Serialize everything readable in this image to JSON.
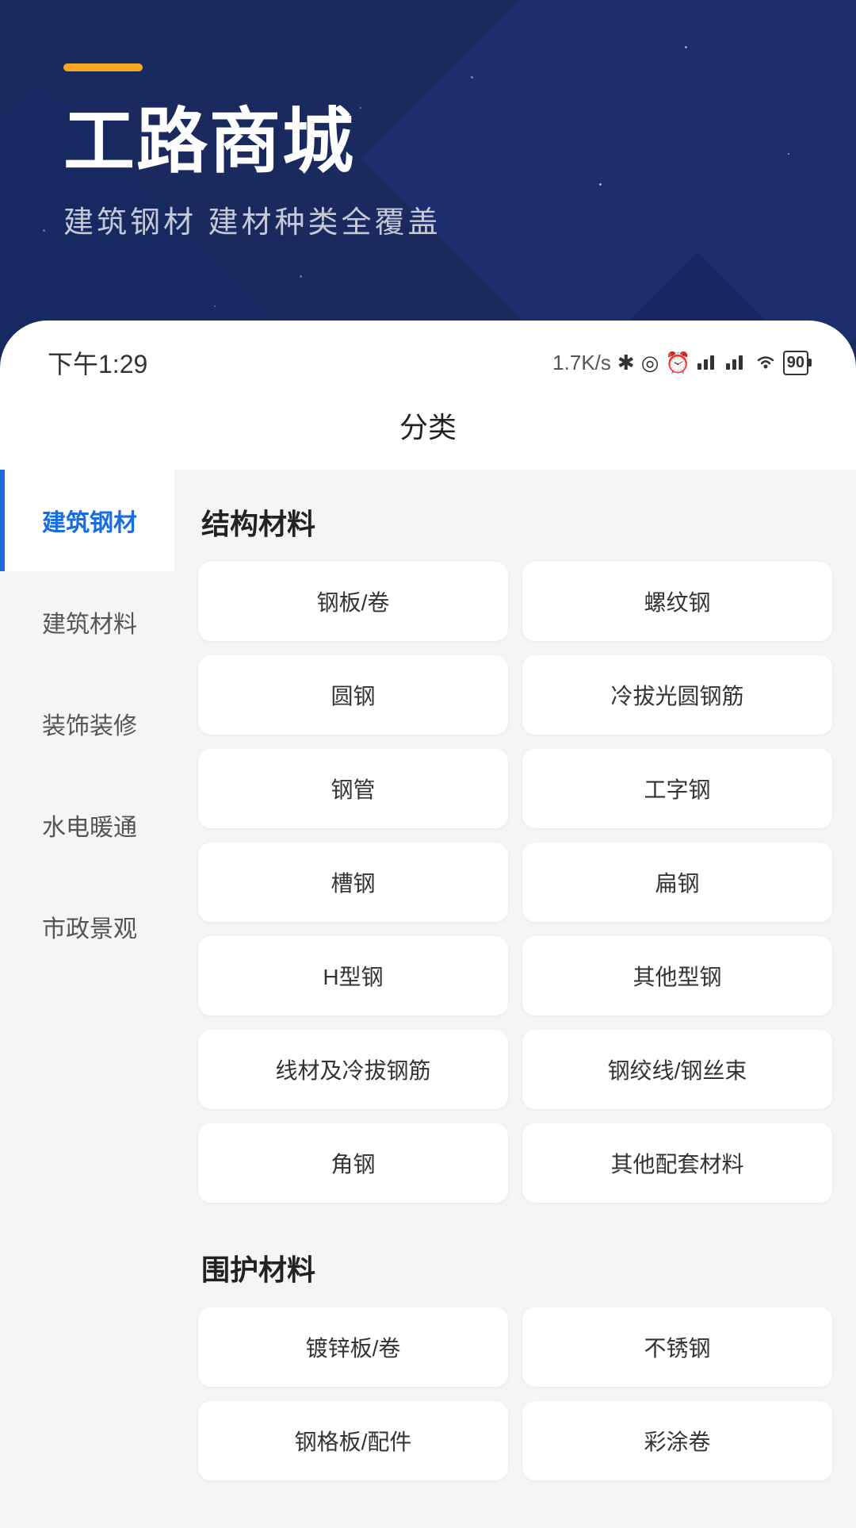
{
  "background": {
    "stars_count": 30
  },
  "header": {
    "orange_bar": true,
    "title": "工路商城",
    "subtitle": "建筑钢材 建材种类全覆盖"
  },
  "status_bar": {
    "time": "下午1:29",
    "speed": "1.7K/s",
    "icons": [
      "bluetooth",
      "vpn",
      "alarm",
      "signal1",
      "signal2",
      "wifi",
      "battery"
    ],
    "battery_level": "90"
  },
  "page_title": "分类",
  "sidebar": {
    "items": [
      {
        "id": "construction-steel",
        "label": "建筑钢材",
        "active": true
      },
      {
        "id": "building-materials",
        "label": "建筑材料",
        "active": false
      },
      {
        "id": "decoration",
        "label": "装饰装修",
        "active": false
      },
      {
        "id": "hvac",
        "label": "水电暖通",
        "active": false
      },
      {
        "id": "municipal",
        "label": "市政景观",
        "active": false
      }
    ]
  },
  "content": {
    "sections": [
      {
        "id": "structural",
        "title": "结构材料",
        "items": [
          "钢板/卷",
          "螺纹钢",
          "圆钢",
          "冷拔光圆钢筋",
          "钢管",
          "工字钢",
          "槽钢",
          "扁钢",
          "H型钢",
          "其他型钢",
          "线材及冷拔钢筋",
          "钢绞线/钢丝束",
          "角钢",
          "其他配套材料"
        ]
      },
      {
        "id": "enclosure",
        "title": "围护材料",
        "items": [
          "镀锌板/卷",
          "不锈钢",
          "钢格板/配件",
          "彩涂卷"
        ]
      }
    ]
  }
}
